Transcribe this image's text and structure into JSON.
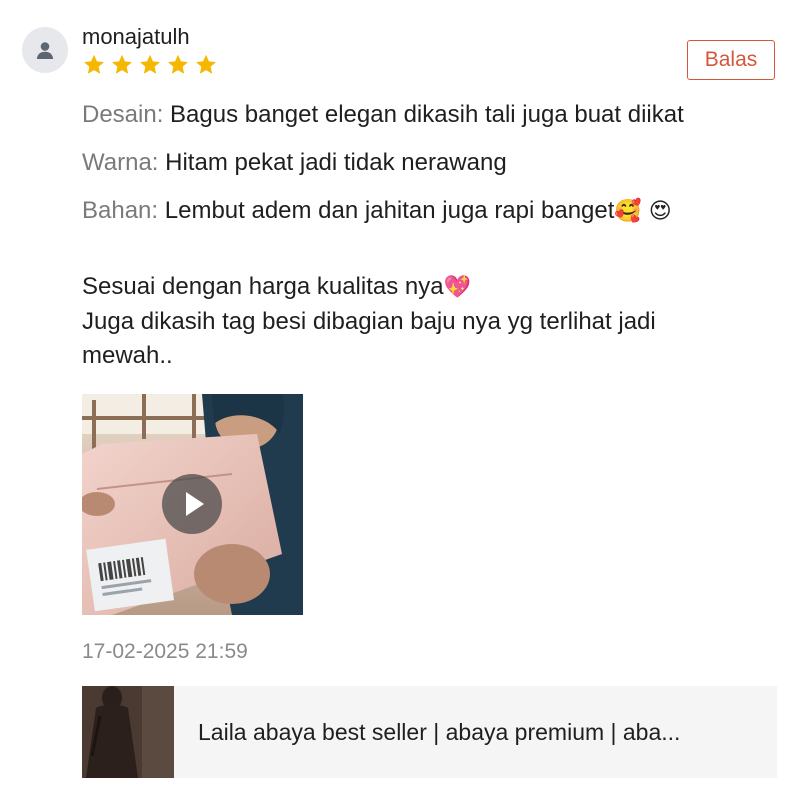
{
  "review": {
    "username": "monajatulh",
    "rating": 5,
    "reply_label": "Balas",
    "attributes": [
      {
        "key": "Desain:",
        "value": "Bagus banget elegan dikasih tali juga buat diikat",
        "emoji": ""
      },
      {
        "key": "Warna:",
        "value": "Hitam pekat jadi tidak nerawang",
        "emoji": ""
      },
      {
        "key": "Bahan:",
        "value": "Lembut adem dan jahitan juga rapi banget",
        "emoji": "🥰 😍"
      }
    ],
    "body": [
      {
        "text": "Sesuai dengan harga kualitas nya",
        "emoji": "💖"
      },
      {
        "text": "Juga dikasih tag besi dibagian baju nya yg terlihat jadi",
        "emoji": ""
      },
      {
        "text": "mewah..",
        "emoji": ""
      }
    ],
    "media": {
      "type": "video",
      "icon": "play-icon"
    },
    "timestamp": "17-02-2025 21:59"
  },
  "product": {
    "name": "Laila abaya best seller | abaya premium | aba..."
  },
  "colors": {
    "accent": "#d5573b",
    "star": "#f5b700",
    "muted_text": "#7a7a7a",
    "timestamp_text": "#8a8a8a",
    "card_bg": "#f5f5f5"
  },
  "icons": {
    "avatar": "user-icon",
    "star": "star-icon",
    "play": "play-icon"
  }
}
